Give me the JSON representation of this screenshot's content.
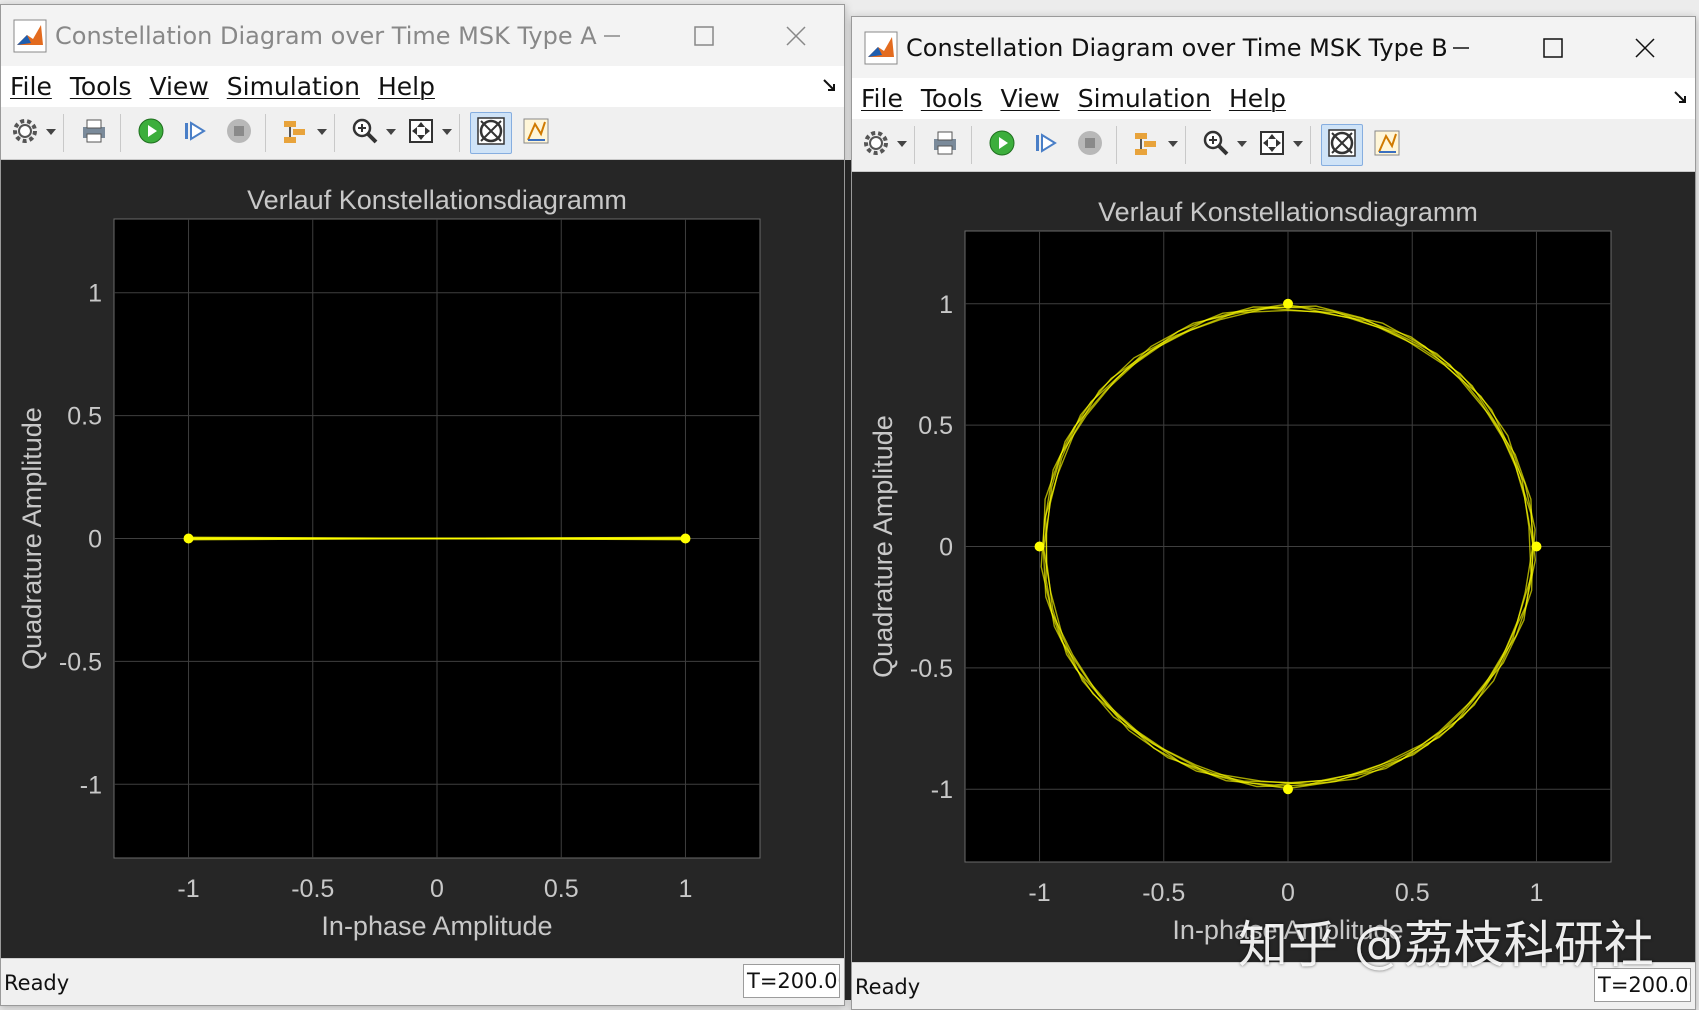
{
  "window_a": {
    "title": "Constellation Diagram over Time MSK Type A",
    "menu": [
      "File",
      "Tools",
      "View",
      "Simulation",
      "Help"
    ],
    "status": "Ready",
    "time": "T=200.00"
  },
  "window_b": {
    "title": "Constellation Diagram over Time MSK Type B",
    "menu": [
      "File",
      "Tools",
      "View",
      "Simulation",
      "Help"
    ],
    "status": "Ready",
    "time": "T=200.00"
  },
  "toolbar_icons": [
    "settings-icon",
    "print-icon",
    "run-icon",
    "step-forward-icon",
    "stop-icon",
    "signal-select-icon",
    "zoom-in-icon",
    "autoscale-icon",
    "constellation-icon",
    "measurements-icon"
  ],
  "chart_data": [
    {
      "type": "scatter",
      "title": "Verlauf Konstellationsdiagramm",
      "xlabel": "In-phase Amplitude",
      "ylabel": "Quadrature Amplitude",
      "xlim": [
        -1.3,
        1.3
      ],
      "ylim": [
        -1.3,
        1.3
      ],
      "xticks": [
        -1,
        -0.5,
        0,
        0.5,
        1
      ],
      "yticks": [
        -1,
        -0.5,
        0,
        0.5,
        1
      ],
      "xticklabels": [
        "-1",
        "-0.5",
        "0",
        "0.5",
        "1"
      ],
      "yticklabels": [
        "-1",
        "-0.5",
        "0",
        "0.5",
        "1"
      ],
      "grid": true,
      "trace": "line",
      "color": "#ffff00",
      "points": [
        [
          -1,
          0
        ],
        [
          1,
          0
        ]
      ]
    },
    {
      "type": "scatter",
      "title": "Verlauf Konstellationsdiagramm",
      "xlabel": "In-phase Amplitude",
      "ylabel": "Quadrature Amplitude",
      "xlim": [
        -1.3,
        1.3
      ],
      "ylim": [
        -1.3,
        1.3
      ],
      "xticks": [
        -1,
        -0.5,
        0,
        0.5,
        1
      ],
      "yticks": [
        -1,
        -0.5,
        0,
        0.5,
        1
      ],
      "xticklabels": [
        "-1",
        "-0.5",
        "0",
        "0.5",
        "1"
      ],
      "yticklabels": [
        "-1",
        "-0.5",
        "0",
        "0.5",
        "1"
      ],
      "grid": true,
      "trace": "circle",
      "radius": 1,
      "color": "#ffff00",
      "points": [
        [
          1,
          0
        ],
        [
          0,
          1
        ],
        [
          -1,
          0
        ],
        [
          0,
          -1
        ]
      ]
    }
  ],
  "watermark": "知乎 @荔枝科研社"
}
